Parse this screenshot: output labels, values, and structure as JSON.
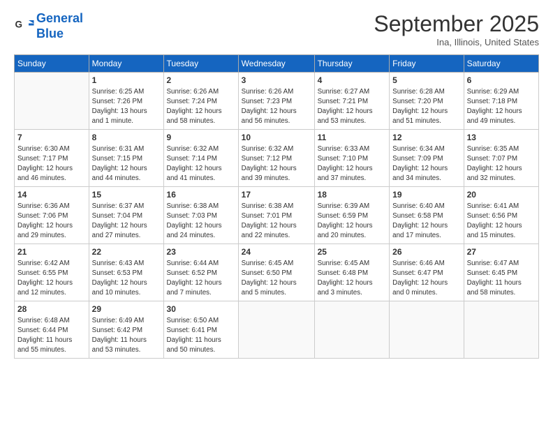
{
  "header": {
    "logo_line1": "General",
    "logo_line2": "Blue",
    "month_title": "September 2025",
    "location": "Ina, Illinois, United States"
  },
  "days_of_week": [
    "Sunday",
    "Monday",
    "Tuesday",
    "Wednesday",
    "Thursday",
    "Friday",
    "Saturday"
  ],
  "weeks": [
    [
      {
        "day": "",
        "info": ""
      },
      {
        "day": "1",
        "info": "Sunrise: 6:25 AM\nSunset: 7:26 PM\nDaylight: 13 hours\nand 1 minute."
      },
      {
        "day": "2",
        "info": "Sunrise: 6:26 AM\nSunset: 7:24 PM\nDaylight: 12 hours\nand 58 minutes."
      },
      {
        "day": "3",
        "info": "Sunrise: 6:26 AM\nSunset: 7:23 PM\nDaylight: 12 hours\nand 56 minutes."
      },
      {
        "day": "4",
        "info": "Sunrise: 6:27 AM\nSunset: 7:21 PM\nDaylight: 12 hours\nand 53 minutes."
      },
      {
        "day": "5",
        "info": "Sunrise: 6:28 AM\nSunset: 7:20 PM\nDaylight: 12 hours\nand 51 minutes."
      },
      {
        "day": "6",
        "info": "Sunrise: 6:29 AM\nSunset: 7:18 PM\nDaylight: 12 hours\nand 49 minutes."
      }
    ],
    [
      {
        "day": "7",
        "info": "Sunrise: 6:30 AM\nSunset: 7:17 PM\nDaylight: 12 hours\nand 46 minutes."
      },
      {
        "day": "8",
        "info": "Sunrise: 6:31 AM\nSunset: 7:15 PM\nDaylight: 12 hours\nand 44 minutes."
      },
      {
        "day": "9",
        "info": "Sunrise: 6:32 AM\nSunset: 7:14 PM\nDaylight: 12 hours\nand 41 minutes."
      },
      {
        "day": "10",
        "info": "Sunrise: 6:32 AM\nSunset: 7:12 PM\nDaylight: 12 hours\nand 39 minutes."
      },
      {
        "day": "11",
        "info": "Sunrise: 6:33 AM\nSunset: 7:10 PM\nDaylight: 12 hours\nand 37 minutes."
      },
      {
        "day": "12",
        "info": "Sunrise: 6:34 AM\nSunset: 7:09 PM\nDaylight: 12 hours\nand 34 minutes."
      },
      {
        "day": "13",
        "info": "Sunrise: 6:35 AM\nSunset: 7:07 PM\nDaylight: 12 hours\nand 32 minutes."
      }
    ],
    [
      {
        "day": "14",
        "info": "Sunrise: 6:36 AM\nSunset: 7:06 PM\nDaylight: 12 hours\nand 29 minutes."
      },
      {
        "day": "15",
        "info": "Sunrise: 6:37 AM\nSunset: 7:04 PM\nDaylight: 12 hours\nand 27 minutes."
      },
      {
        "day": "16",
        "info": "Sunrise: 6:38 AM\nSunset: 7:03 PM\nDaylight: 12 hours\nand 24 minutes."
      },
      {
        "day": "17",
        "info": "Sunrise: 6:38 AM\nSunset: 7:01 PM\nDaylight: 12 hours\nand 22 minutes."
      },
      {
        "day": "18",
        "info": "Sunrise: 6:39 AM\nSunset: 6:59 PM\nDaylight: 12 hours\nand 20 minutes."
      },
      {
        "day": "19",
        "info": "Sunrise: 6:40 AM\nSunset: 6:58 PM\nDaylight: 12 hours\nand 17 minutes."
      },
      {
        "day": "20",
        "info": "Sunrise: 6:41 AM\nSunset: 6:56 PM\nDaylight: 12 hours\nand 15 minutes."
      }
    ],
    [
      {
        "day": "21",
        "info": "Sunrise: 6:42 AM\nSunset: 6:55 PM\nDaylight: 12 hours\nand 12 minutes."
      },
      {
        "day": "22",
        "info": "Sunrise: 6:43 AM\nSunset: 6:53 PM\nDaylight: 12 hours\nand 10 minutes."
      },
      {
        "day": "23",
        "info": "Sunrise: 6:44 AM\nSunset: 6:52 PM\nDaylight: 12 hours\nand 7 minutes."
      },
      {
        "day": "24",
        "info": "Sunrise: 6:45 AM\nSunset: 6:50 PM\nDaylight: 12 hours\nand 5 minutes."
      },
      {
        "day": "25",
        "info": "Sunrise: 6:45 AM\nSunset: 6:48 PM\nDaylight: 12 hours\nand 3 minutes."
      },
      {
        "day": "26",
        "info": "Sunrise: 6:46 AM\nSunset: 6:47 PM\nDaylight: 12 hours\nand 0 minutes."
      },
      {
        "day": "27",
        "info": "Sunrise: 6:47 AM\nSunset: 6:45 PM\nDaylight: 11 hours\nand 58 minutes."
      }
    ],
    [
      {
        "day": "28",
        "info": "Sunrise: 6:48 AM\nSunset: 6:44 PM\nDaylight: 11 hours\nand 55 minutes."
      },
      {
        "day": "29",
        "info": "Sunrise: 6:49 AM\nSunset: 6:42 PM\nDaylight: 11 hours\nand 53 minutes."
      },
      {
        "day": "30",
        "info": "Sunrise: 6:50 AM\nSunset: 6:41 PM\nDaylight: 11 hours\nand 50 minutes."
      },
      {
        "day": "",
        "info": ""
      },
      {
        "day": "",
        "info": ""
      },
      {
        "day": "",
        "info": ""
      },
      {
        "day": "",
        "info": ""
      }
    ]
  ]
}
